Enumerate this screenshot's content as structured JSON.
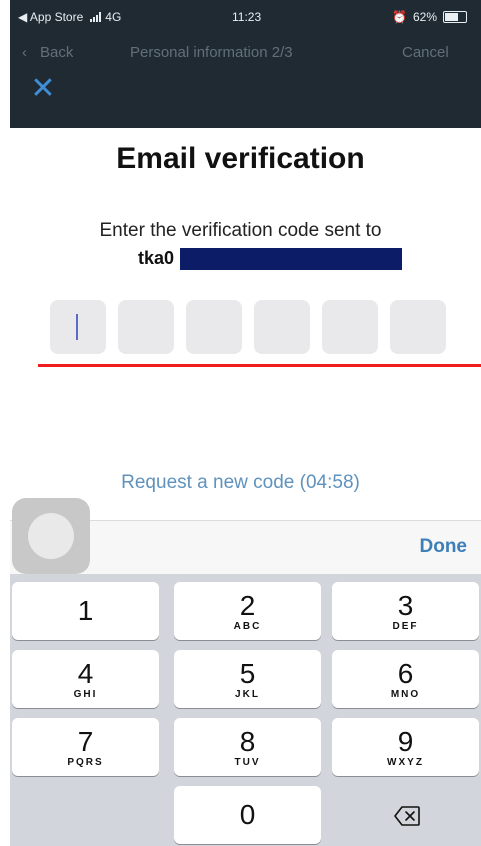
{
  "status_bar": {
    "carrier": "◀ App Store",
    "network": "4G",
    "time": "11:23",
    "battery": "62%"
  },
  "nav_ghost": {
    "back": "Back",
    "title": "Personal information 2/3",
    "cancel": "Cancel"
  },
  "header": {
    "close_icon": "✕"
  },
  "verification": {
    "title": "Email verification",
    "instruction": "Enter the verification code sent to",
    "email_visible": "tka0",
    "code_boxes": [
      "",
      "",
      "",
      "",
      "",
      ""
    ]
  },
  "request_code": {
    "label": "Request a new code (04:58)"
  },
  "keyboard_bar": {
    "done_label": "Done"
  },
  "keypad": {
    "keys": [
      {
        "digit": "1",
        "letters": ""
      },
      {
        "digit": "2",
        "letters": "ABC"
      },
      {
        "digit": "3",
        "letters": "DEF"
      },
      {
        "digit": "4",
        "letters": "GHI"
      },
      {
        "digit": "5",
        "letters": "JKL"
      },
      {
        "digit": "6",
        "letters": "MNO"
      },
      {
        "digit": "7",
        "letters": "PQRS"
      },
      {
        "digit": "8",
        "letters": "TUV"
      },
      {
        "digit": "9",
        "letters": "WXYZ"
      },
      {
        "digit": "0",
        "letters": ""
      }
    ],
    "delete_icon": "backspace-icon"
  },
  "colors": {
    "nav_bg": "#1f2a33",
    "accent": "#3f8fd6",
    "link": "#5f92bd",
    "annotation_red": "#ef1d1d",
    "redaction": "#0d1c67"
  }
}
